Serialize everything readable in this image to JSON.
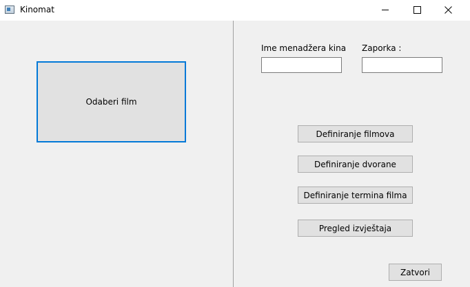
{
  "window": {
    "title": "Kinomat",
    "icon": "app-window-icon",
    "controls": [
      "minimize",
      "maximize",
      "close"
    ]
  },
  "left_panel": {
    "select_film_label": "Odaberi film"
  },
  "login": {
    "manager_label": "Ime menadžera kina",
    "manager_value": "",
    "password_label": "Zaporka :",
    "password_value": ""
  },
  "actions": {
    "define_films": "Definiranje filmova",
    "define_hall": "Definiranje dvorane",
    "define_schedule": "Definiranje termina filma",
    "view_reports": "Pregled izvještaja",
    "close": "Zatvori"
  },
  "colors": {
    "focus_border": "#0078d7",
    "button_bg": "#e1e1e1",
    "window_bg": "#f0f0f0"
  }
}
